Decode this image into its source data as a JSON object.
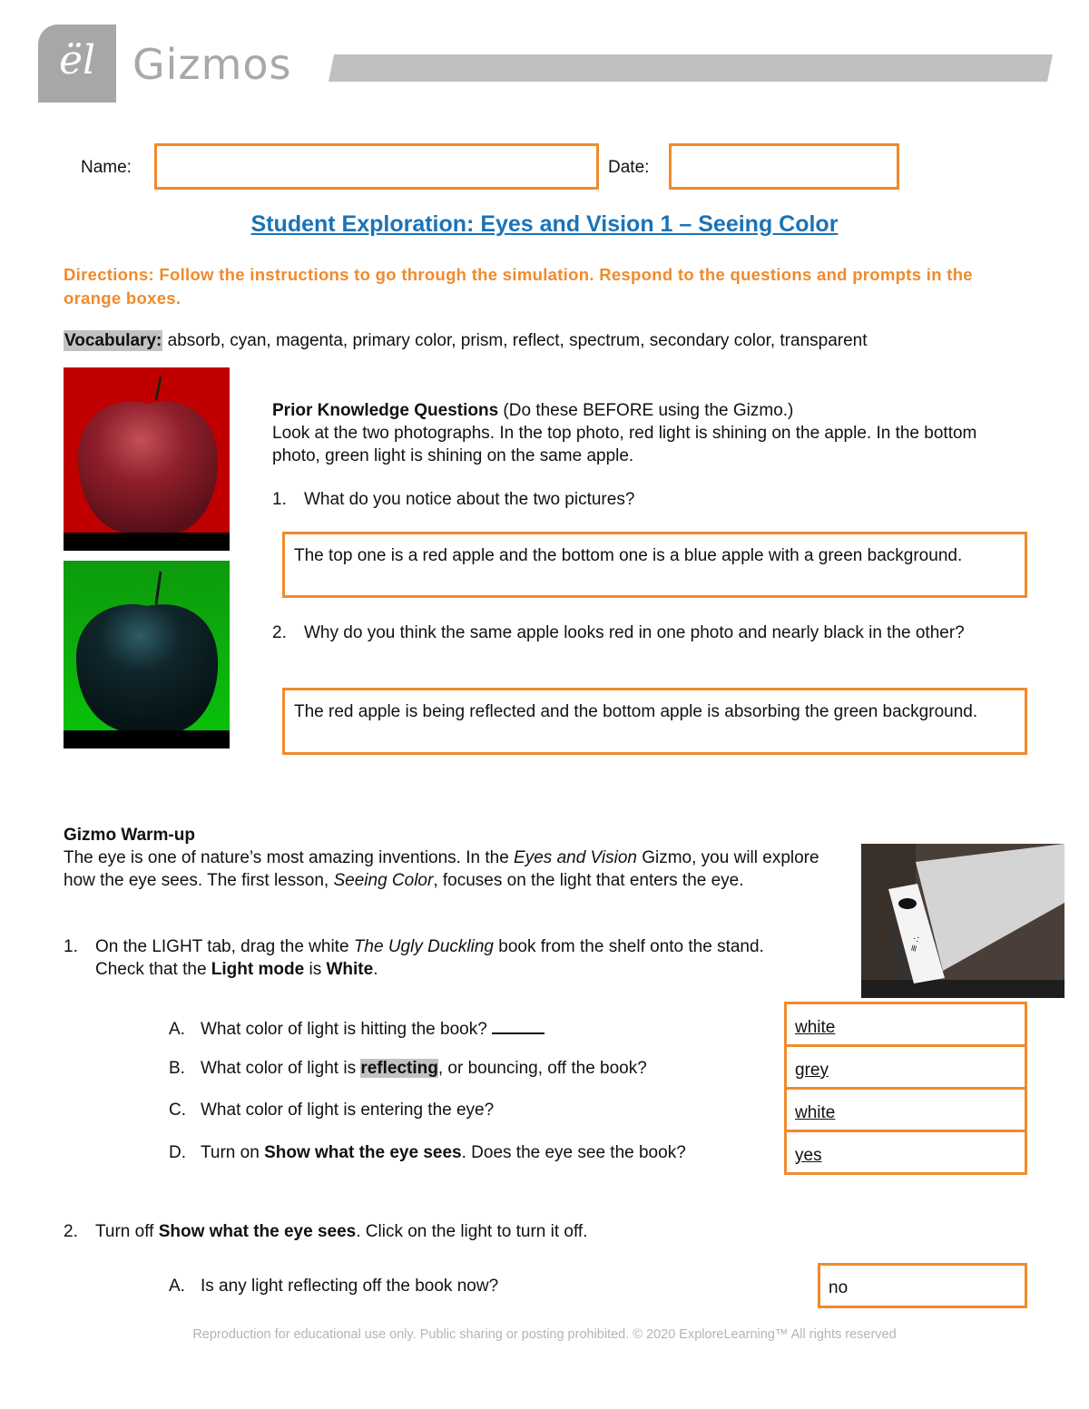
{
  "header": {
    "logo_glyph": "ël",
    "brand": "Gizmos",
    "colors": {
      "logo_gray": "#a7a7a7",
      "bar_gray": "#c0c0c0"
    }
  },
  "form": {
    "name_label": "Name:",
    "name_value": "",
    "date_label": "Date:",
    "date_value": ""
  },
  "title": "Student Exploration: Eyes and Vision 1 – Seeing Color",
  "directions": "Directions: Follow the instructions to go through the simulation. Respond to the questions and prompts in the orange boxes.",
  "vocabulary": {
    "label": "Vocabulary:",
    "terms": " absorb, cyan, magenta, primary color, prism, reflect, spectrum, secondary color, transparent"
  },
  "photos": {
    "top_alt": "Apple under red light",
    "bottom_alt": "Apple under green light"
  },
  "prior_knowledge": {
    "heading": "Prior Knowledge Questions",
    "heading_note": " (Do these BEFORE using the Gizmo.)",
    "intro": "Look at the two photographs. In the top photo, red light is shining on the apple. In the bottom photo, green light is shining on the same apple.",
    "questions": [
      {
        "number": "1.",
        "text": "What do you notice about the two pictures?",
        "answer": "The top one is a red apple and the bottom one is a blue apple with a green background."
      },
      {
        "number": "2.",
        "text": "Why do you think the same apple looks red in one photo and nearly black in the other?",
        "answer": "The red apple is being reflected and the bottom apple is absorbing the green background."
      }
    ]
  },
  "warmup": {
    "heading": "Gizmo Warm-up",
    "intro_1": "The eye is one of nature’s most amazing inventions. In the ",
    "intro_italic_1": "Eyes and Vision",
    "intro_2": " Gizmo, you will explore how the eye sees. The first lesson, ",
    "intro_italic_2": "Seeing Color",
    "intro_3": ", focuses on the light that enters the eye.",
    "step1": {
      "number": "1.",
      "text_1": "On the LIGHT tab, drag the white ",
      "italic": "The Ugly Duckling",
      "text_2": " book from the shelf onto the stand. Check that the ",
      "bold_1": "Light mode",
      "text_3": " is ",
      "bold_2": "White",
      "text_4": ".",
      "sub": [
        {
          "letter": "A.",
          "text": "What color of light is hitting the book? ",
          "answer": "white"
        },
        {
          "letter": "B.",
          "pre": "What color of light is ",
          "highlight": "reflecting",
          "post": ", or bouncing, off the book?",
          "answer": "grey"
        },
        {
          "letter": "C.",
          "text": "What color of light is entering the eye?",
          "answer": "white"
        },
        {
          "letter": "D.",
          "pre": "Turn on ",
          "bold": "Show what the eye sees",
          "post": ". Does the eye see the book?",
          "answer": "yes"
        }
      ]
    },
    "step2": {
      "number": "2.",
      "pre": "Turn off ",
      "bold": "Show what the eye sees",
      "post": ". Click on the light to turn it off.",
      "sub": [
        {
          "letter": "A.",
          "text": "Is any light reflecting off the book now?",
          "answer": "no"
        }
      ]
    }
  },
  "footer": "Reproduction for educational use only. Public sharing or posting prohibited. © 2020 ExploreLearning™ All rights reserved",
  "colors": {
    "accent_orange": "#f08a2c",
    "title_blue": "#1a73b8",
    "highlight_gray": "#c2c2c2"
  }
}
